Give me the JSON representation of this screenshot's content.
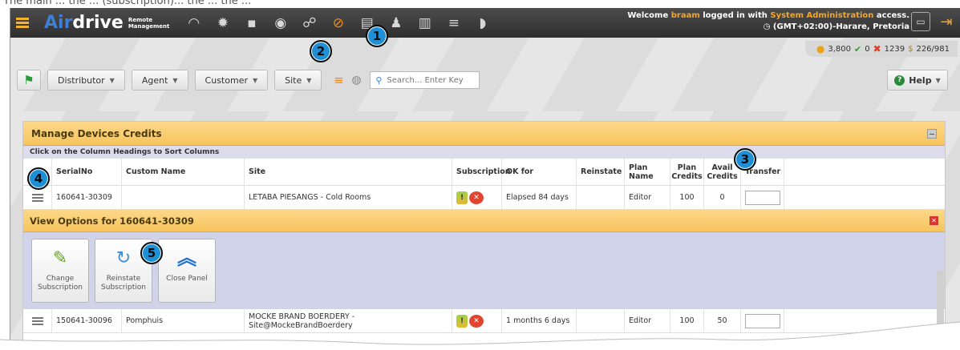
{
  "caption": "The main ... the ... (subscription)... the ... the ...",
  "header": {
    "logo_air": "Air",
    "logo_drive": "drive",
    "logo_sub": "Remote Management",
    "welcome_prefix": "Welcome",
    "username": "braam",
    "welcome_mid": "logged in with",
    "access": "System Administration",
    "welcome_suffix": "access.",
    "timezone": "(GMT+02:00)-Harare, Pretoria",
    "nav_icons": [
      "dashboard-icon",
      "settings-icon",
      "grid-icon",
      "eye-icon",
      "hierarchy-icon",
      "subscription-icon",
      "report-icon",
      "users-icon",
      "book-icon",
      "list-icon",
      "bell-icon"
    ]
  },
  "stats": {
    "coins": "3,800",
    "ok": "0",
    "failed": "1239",
    "ratio": "226/981"
  },
  "filters": {
    "distributor": "Distributor",
    "agent": "Agent",
    "customer": "Customer",
    "site": "Site",
    "search_placeholder": "Search... Enter Key",
    "help": "Help"
  },
  "panel": {
    "title": "Manage Devices Credits",
    "sort_hint": "Click on the Column Headings to Sort Columns",
    "columns": [
      "SerialNo",
      "Custom Name",
      "Site",
      "Subscription",
      "OK for",
      "Reinstate",
      "Plan Name",
      "Plan Credits",
      "Avail Credits",
      "Transfer"
    ],
    "rows": [
      {
        "serial": "160641-30309",
        "custom_name": "",
        "site": "LETABA PIESANGS - Cold Rooms",
        "ok_for": "Elapsed 84 days",
        "reinstate": "",
        "plan_name": "Editor",
        "plan_credits": "100",
        "avail_credits": "0"
      },
      {
        "serial": "150641-30096",
        "custom_name": "Pomphuis",
        "site": "MOCKE BRAND BOERDERY - Site@MockeBrandBoerdery",
        "ok_for": "1 months 6 days",
        "reinstate": "",
        "plan_name": "Editor",
        "plan_credits": "100",
        "avail_credits": "50"
      }
    ]
  },
  "view_options": {
    "title": "View Options for 160641-30309",
    "buttons": [
      "Change Subscription",
      "Reinstate Subscription",
      "Close Panel"
    ]
  },
  "badges": [
    "1",
    "2",
    "3",
    "4",
    "5"
  ]
}
